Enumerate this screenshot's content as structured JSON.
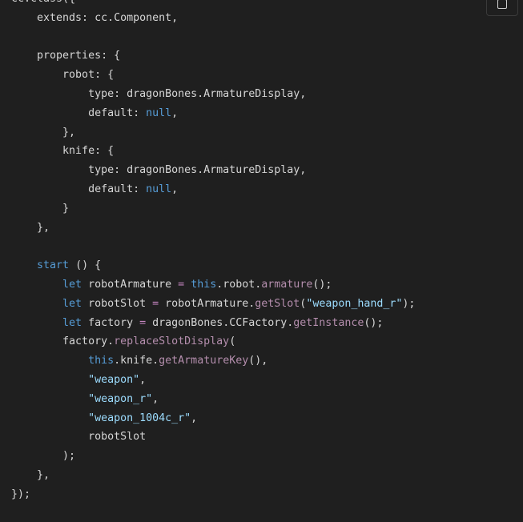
{
  "copy_button": {
    "icon": "copy-icon"
  },
  "colors": {
    "background": "#1f1f1f",
    "plain": "#d6d6d6",
    "keyword": "#569cd6",
    "method": "#c586c0",
    "string": "#9cdcfe"
  },
  "code_lines": [
    [
      {
        "t": "plain",
        "v": "cc.class({"
      }
    ],
    [
      {
        "t": "plain",
        "v": "    extends: cc.Component,"
      }
    ],
    [
      {
        "t": "plain",
        "v": ""
      }
    ],
    [
      {
        "t": "plain",
        "v": "    properties: {"
      }
    ],
    [
      {
        "t": "plain",
        "v": "        robot: {"
      }
    ],
    [
      {
        "t": "plain",
        "v": "            type: dragonBones.ArmatureDisplay,"
      }
    ],
    [
      {
        "t": "plain",
        "v": "            default: "
      },
      {
        "t": "null",
        "v": "null"
      },
      {
        "t": "plain",
        "v": ","
      }
    ],
    [
      {
        "t": "plain",
        "v": "        },"
      }
    ],
    [
      {
        "t": "plain",
        "v": "        knife: {"
      }
    ],
    [
      {
        "t": "plain",
        "v": "            type: dragonBones.ArmatureDisplay,"
      }
    ],
    [
      {
        "t": "plain",
        "v": "            default: "
      },
      {
        "t": "null",
        "v": "null"
      },
      {
        "t": "plain",
        "v": ","
      }
    ],
    [
      {
        "t": "plain",
        "v": "        }"
      }
    ],
    [
      {
        "t": "plain",
        "v": "    },"
      }
    ],
    [
      {
        "t": "plain",
        "v": ""
      }
    ],
    [
      {
        "t": "plain",
        "v": "    "
      },
      {
        "t": "kw",
        "v": "start"
      },
      {
        "t": "plain",
        "v": " () {"
      }
    ],
    [
      {
        "t": "plain",
        "v": "        "
      },
      {
        "t": "kw",
        "v": "let"
      },
      {
        "t": "plain",
        "v": " robotArmature "
      },
      {
        "t": "op",
        "v": "="
      },
      {
        "t": "plain",
        "v": " "
      },
      {
        "t": "kw",
        "v": "this"
      },
      {
        "t": "plain",
        "v": ".robot."
      },
      {
        "t": "method",
        "v": "armature"
      },
      {
        "t": "plain",
        "v": "();"
      }
    ],
    [
      {
        "t": "plain",
        "v": "        "
      },
      {
        "t": "kw",
        "v": "let"
      },
      {
        "t": "plain",
        "v": " robotSlot "
      },
      {
        "t": "op",
        "v": "="
      },
      {
        "t": "plain",
        "v": " robotArmature."
      },
      {
        "t": "method",
        "v": "getSlot"
      },
      {
        "t": "plain",
        "v": "("
      },
      {
        "t": "str",
        "v": "\"weapon_hand_r\""
      },
      {
        "t": "plain",
        "v": ");"
      }
    ],
    [
      {
        "t": "plain",
        "v": "        "
      },
      {
        "t": "kw",
        "v": "let"
      },
      {
        "t": "plain",
        "v": " factory "
      },
      {
        "t": "op",
        "v": "="
      },
      {
        "t": "plain",
        "v": " dragonBones.CCFactory."
      },
      {
        "t": "method",
        "v": "getInstance"
      },
      {
        "t": "plain",
        "v": "();"
      }
    ],
    [
      {
        "t": "plain",
        "v": "        factory."
      },
      {
        "t": "method",
        "v": "replaceSlotDisplay"
      },
      {
        "t": "plain",
        "v": "("
      }
    ],
    [
      {
        "t": "plain",
        "v": "            "
      },
      {
        "t": "kw",
        "v": "this"
      },
      {
        "t": "plain",
        "v": ".knife."
      },
      {
        "t": "method",
        "v": "getArmatureKey"
      },
      {
        "t": "plain",
        "v": "(),"
      }
    ],
    [
      {
        "t": "plain",
        "v": "            "
      },
      {
        "t": "str",
        "v": "\"weapon\""
      },
      {
        "t": "plain",
        "v": ","
      }
    ],
    [
      {
        "t": "plain",
        "v": "            "
      },
      {
        "t": "str",
        "v": "\"weapon_r\""
      },
      {
        "t": "plain",
        "v": ","
      }
    ],
    [
      {
        "t": "plain",
        "v": "            "
      },
      {
        "t": "str",
        "v": "\"weapon_1004c_r\""
      },
      {
        "t": "plain",
        "v": ","
      }
    ],
    [
      {
        "t": "plain",
        "v": "            robotSlot"
      }
    ],
    [
      {
        "t": "plain",
        "v": "        );"
      }
    ],
    [
      {
        "t": "plain",
        "v": "    },"
      }
    ],
    [
      {
        "t": "plain",
        "v": "});"
      }
    ]
  ]
}
